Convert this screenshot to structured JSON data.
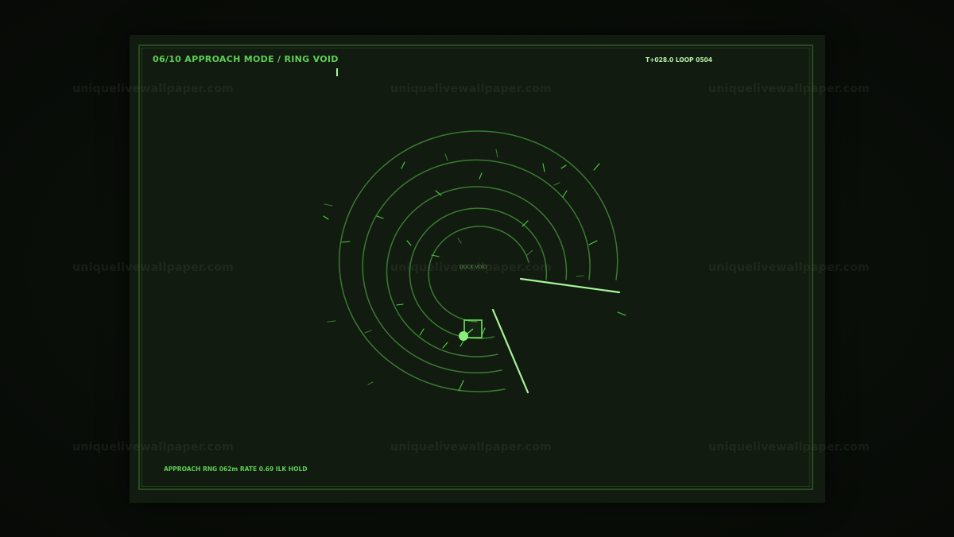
{
  "hud": {
    "title": "06/10  APPROACH MODE / RING VOID",
    "clock": "T+028.0  LOOP 0504",
    "status": "APPROACH  RNG 062m  RATE 0.69  ILK HOLD",
    "dock_label": "DOCK VOID"
  },
  "watermark": "uniquelivewallpaper.com",
  "colors": {
    "background": "#0a0f09",
    "screen": "#111b0f",
    "accent": "#5fcf55",
    "highlight": "#a8f59a",
    "ring": "#3a7a32"
  }
}
